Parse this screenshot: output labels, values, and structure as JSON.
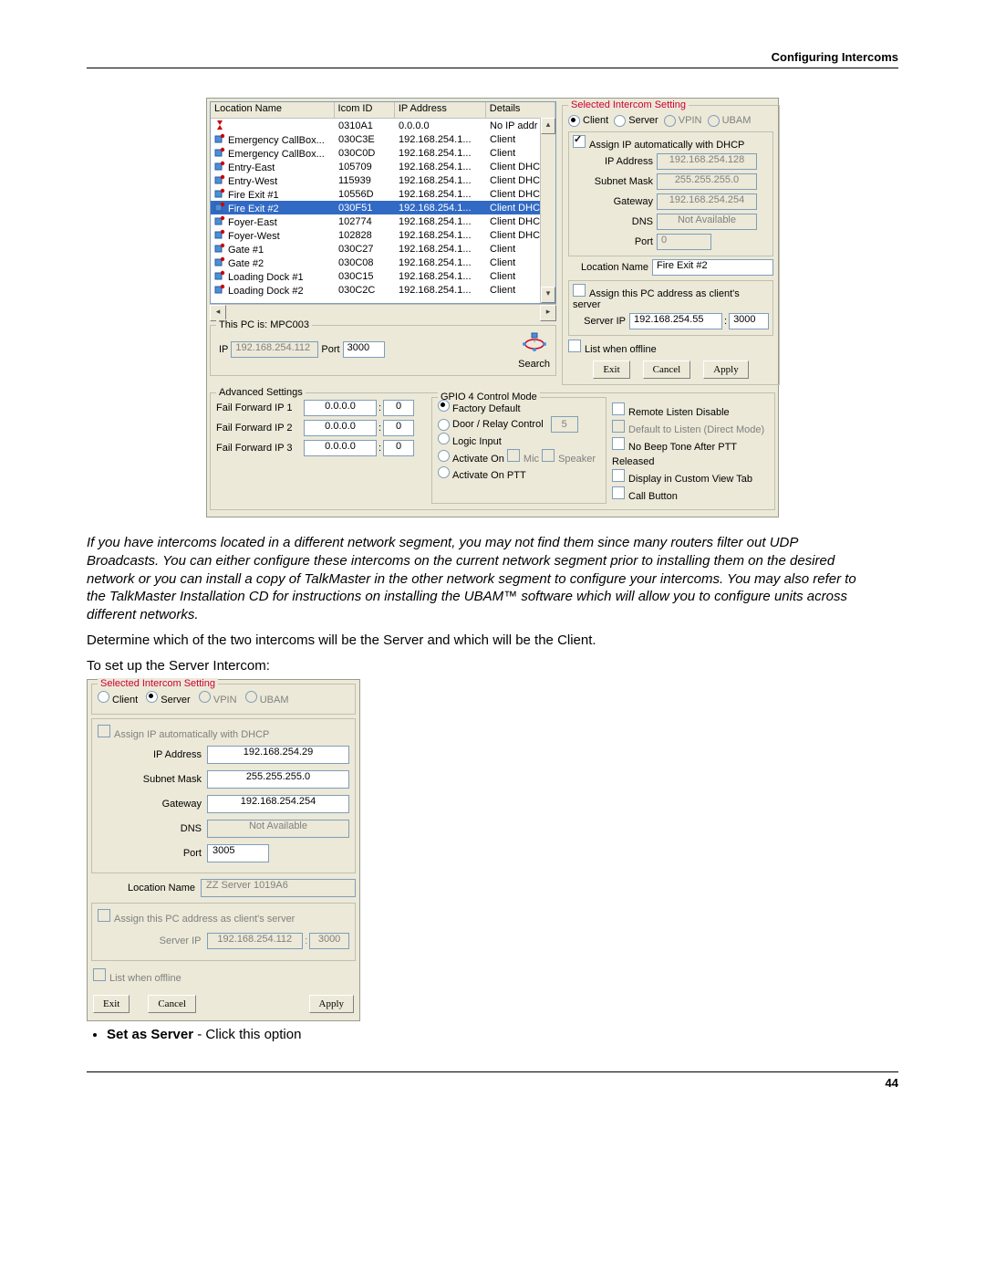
{
  "header": "Configuring Intercoms",
  "footer": "44",
  "listview": {
    "cols": [
      "Location Name",
      "Icom ID",
      "IP Address",
      "Details"
    ],
    "rows": [
      {
        "loc": "",
        "id": "0310A1",
        "ip": "0.0.0.0",
        "det": "No IP addr",
        "icon": "hg"
      },
      {
        "loc": "Emergency CallBox...",
        "id": "030C3E",
        "ip": "192.168.254.1...",
        "det": "Client",
        "icon": "ic"
      },
      {
        "loc": "Emergency CallBox...",
        "id": "030C0D",
        "ip": "192.168.254.1...",
        "det": "Client",
        "icon": "ic"
      },
      {
        "loc": "Entry-East",
        "id": "105709",
        "ip": "192.168.254.1...",
        "det": "Client DHCP",
        "icon": "ic"
      },
      {
        "loc": "Entry-West",
        "id": "115939",
        "ip": "192.168.254.1...",
        "det": "Client DHCP",
        "icon": "ic"
      },
      {
        "loc": "Fire Exit #1",
        "id": "10556D",
        "ip": "192.168.254.1...",
        "det": "Client DHCP",
        "icon": "ic"
      },
      {
        "loc": "Fire Exit #2",
        "id": "030F51",
        "ip": "192.168.254.1...",
        "det": "Client DHCP",
        "icon": "ic",
        "sel": true
      },
      {
        "loc": "Foyer-East",
        "id": "102774",
        "ip": "192.168.254.1...",
        "det": "Client DHCP",
        "icon": "ic"
      },
      {
        "loc": "Foyer-West",
        "id": "102828",
        "ip": "192.168.254.1...",
        "det": "Client DHCP",
        "icon": "ic"
      },
      {
        "loc": "Gate #1",
        "id": "030C27",
        "ip": "192.168.254.1...",
        "det": "Client",
        "icon": "ic"
      },
      {
        "loc": "Gate #2",
        "id": "030C08",
        "ip": "192.168.254.1...",
        "det": "Client",
        "icon": "ic"
      },
      {
        "loc": "Loading Dock #1",
        "id": "030C15",
        "ip": "192.168.254.1...",
        "det": "Client",
        "icon": "ic"
      },
      {
        "loc": "Loading Dock #2",
        "id": "030C2C",
        "ip": "192.168.254.1...",
        "det": "Client",
        "icon": "ic"
      }
    ]
  },
  "thispc": {
    "legend": "This PC is: MPC003",
    "ip_lbl": "IP",
    "ip": "192.168.254.112",
    "port_lbl": "Port",
    "port": "3000",
    "search": "Search"
  },
  "sis": {
    "legend": "Selected Intercom Setting",
    "type_client": "Client",
    "type_server": "Server",
    "type_vpin": "VPIN",
    "type_ubam": "UBAM",
    "dhcp": "Assign IP automatically with  DHCP",
    "ip_lbl": "IP Address",
    "ip": "192.168.254.128",
    "mask_lbl": "Subnet Mask",
    "mask": "255.255.255.0",
    "gw_lbl": "Gateway",
    "gw": "192.168.254.254",
    "dns_lbl": "DNS",
    "dns": "Not Available",
    "port_lbl": "Port",
    "port": "0",
    "loc_lbl": "Location Name",
    "loc": "Fire Exit #2",
    "assign_srv": "Assign this PC address as client's server",
    "srv_ip_lbl": "Server IP",
    "srv_ip": "192.168.254.55",
    "srv_port": "3000",
    "list_offline": "List when offline",
    "exit": "Exit",
    "cancel": "Cancel",
    "apply": "Apply"
  },
  "adv": {
    "legend": "Advanced Settings",
    "ff1_lbl": "Fail Forward IP 1",
    "ff1_ip": "0.0.0.0",
    "ff1_port": "0",
    "ff2_lbl": "Fail Forward IP 2",
    "ff2_ip": "0.0.0.0",
    "ff2_port": "0",
    "ff3_lbl": "Fail Forward IP 3",
    "ff3_ip": "0.0.0.0",
    "ff3_port": "0",
    "gpio_legend": "GPIO 4 Control Mode",
    "gpio_fd": "Factory Default",
    "gpio_door": "Door / Relay Control",
    "gpio_door_val": "5",
    "gpio_logic": "Logic Input",
    "gpio_act_on": "Activate On",
    "gpio_mic": "Mic",
    "gpio_spk": "Speaker",
    "gpio_ptt": "Activate On PTT",
    "rld": "Remote Listen Disable",
    "dtl": "Default to Listen (Direct Mode)",
    "nobeep": "No Beep Tone After PTT Released",
    "custview": "Display in Custom View Tab",
    "callbtn": "Call Button"
  },
  "para1": "If you have intercoms located in a different network segment, you may not find them since many routers filter out UDP Broadcasts.  You can either configure these intercoms on the current network segment prior to installing them on the desired network or you can install a copy of TalkMaster in the other network segment to configure your intercoms. You may also refer to the TalkMaster Installation CD for instructions on installing the UBAM™  software which will allow you to configure units across different networks.",
  "para2": "Determine which of the two intercoms will be the Server and which will be the Client.",
  "para3": "To set up the Server Intercom:",
  "sis2": {
    "legend": "Selected Intercom Setting",
    "type_client": "Client",
    "type_server": "Server",
    "type_vpin": "VPIN",
    "type_ubam": "UBAM",
    "dhcp": "Assign IP automatically with  DHCP",
    "ip_lbl": "IP Address",
    "ip": "192.168.254.29",
    "mask_lbl": "Subnet Mask",
    "mask": "255.255.255.0",
    "gw_lbl": "Gateway",
    "gw": "192.168.254.254",
    "dns_lbl": "DNS",
    "dns": "Not Available",
    "port_lbl": "Port",
    "port": "3005",
    "loc_lbl": "Location Name",
    "loc": "ZZ Server 1019A6",
    "assign_srv": "Assign this PC address as client's server",
    "srv_ip_lbl": "Server IP",
    "srv_ip": "192.168.254.112",
    "srv_port": "3000",
    "list_offline": "List when offline",
    "exit": "Exit",
    "cancel": "Cancel",
    "apply": "Apply"
  },
  "bullet1_b": "Set as Server",
  "bullet1_t": " - Click this option"
}
